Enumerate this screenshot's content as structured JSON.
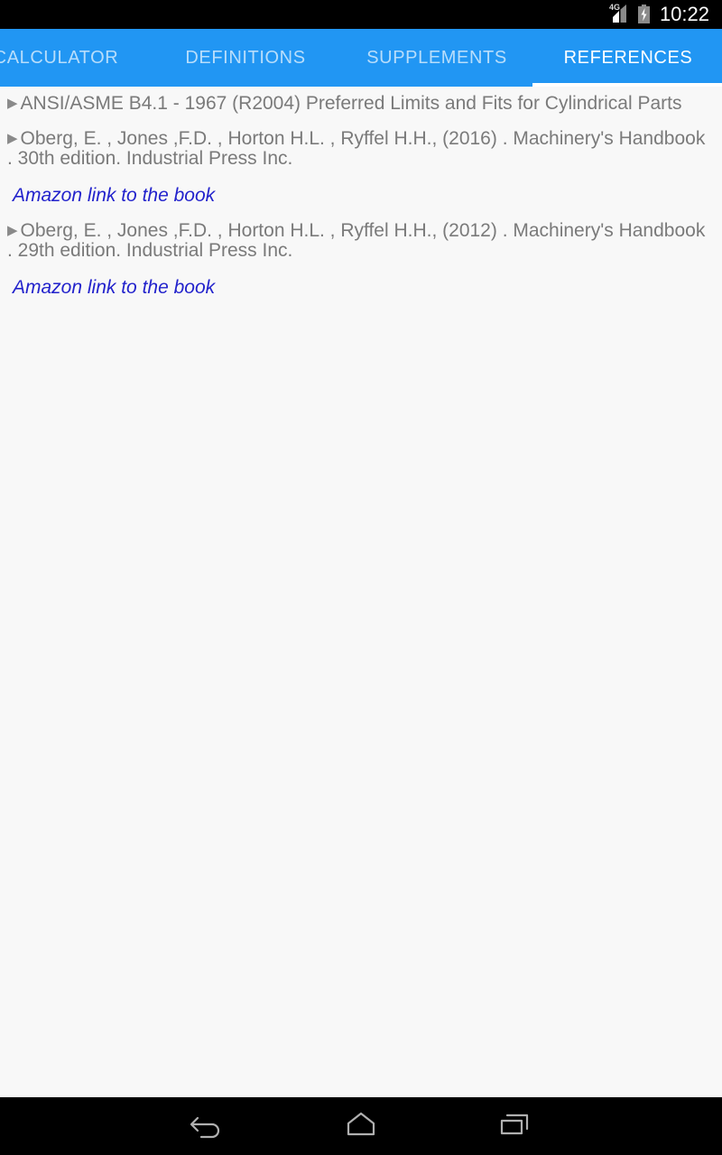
{
  "status_bar": {
    "network_label": "4G",
    "signal_icon": "signal-bars-icon",
    "battery_icon": "battery-charging-icon",
    "time": "10:22"
  },
  "tabs": {
    "accent_color": "#2196F3",
    "items": [
      {
        "label": "CALCULATOR",
        "active": false
      },
      {
        "label": "DEFINITIONS",
        "active": false
      },
      {
        "label": "SUPPLEMENTS",
        "active": false
      },
      {
        "label": "REFERENCES",
        "active": true
      }
    ]
  },
  "content": {
    "background_color": "#F8F8F8",
    "text_color": "#7A7A7A",
    "link_color": "#2222CC",
    "bullet_glyph": "▶",
    "references": [
      {
        "citation": "ANSI/ASME B4.1 - 1967 (R2004) Preferred Limits and Fits for Cylindrical Parts",
        "link": null
      },
      {
        "citation": "Oberg, E. , Jones ,F.D. , Horton H.L. , Ryffel H.H., (2016) . Machinery's Handbook . 30th edition.  Industrial Press Inc.",
        "link": "Amazon link to the book"
      },
      {
        "citation": "Oberg, E. , Jones ,F.D. , Horton H.L. , Ryffel H.H., (2012) . Machinery's Handbook . 29th edition.  Industrial Press Inc.",
        "link": "Amazon link to the book"
      }
    ]
  },
  "nav_bar": {
    "background_color": "#000000",
    "buttons": [
      {
        "name": "back-icon"
      },
      {
        "name": "home-icon"
      },
      {
        "name": "recents-icon"
      }
    ]
  }
}
